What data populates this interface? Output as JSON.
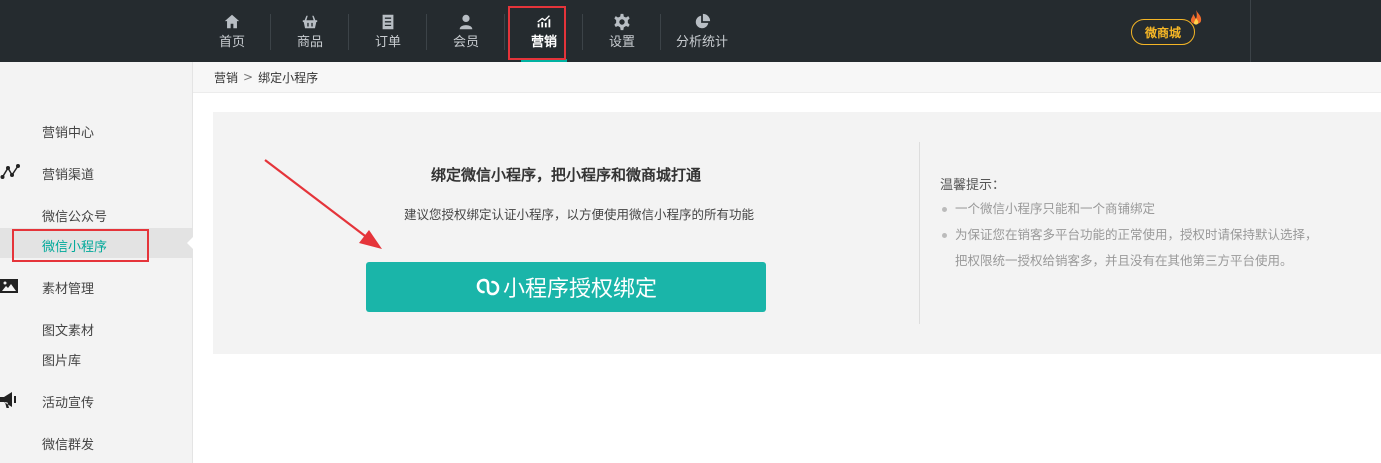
{
  "nav": {
    "items": [
      {
        "label": "首页",
        "icon": "home-icon"
      },
      {
        "label": "商品",
        "icon": "basket-icon"
      },
      {
        "label": "订单",
        "icon": "order-icon"
      },
      {
        "label": "会员",
        "icon": "user-icon"
      },
      {
        "label": "营销",
        "icon": "chart-up-icon",
        "active": true
      },
      {
        "label": "设置",
        "icon": "gear-icon"
      },
      {
        "label": "分析统计",
        "icon": "pie-icon"
      }
    ],
    "shop_badge": "微商城"
  },
  "breadcrumb": {
    "root": "营销",
    "separator": ">",
    "current": "绑定小程序"
  },
  "sidebar": {
    "items": [
      {
        "label": "营销中心"
      },
      {
        "label": "营销渠道",
        "icon": "channel-icon"
      },
      {
        "label": "微信公众号"
      },
      {
        "label": "微信小程序",
        "active": true
      },
      {
        "label": "素材管理",
        "icon": "image-icon"
      },
      {
        "label": "图文素材"
      },
      {
        "label": "图片库"
      },
      {
        "label": "活动宣传",
        "icon": "megaphone-icon"
      },
      {
        "label": "微信群发"
      }
    ]
  },
  "main": {
    "title": "绑定微信小程序，把小程序和微商城打通",
    "description": "建议您授权绑定认证小程序，以方便使用微信小程序的所有功能",
    "bind_button_label": "小程序授权绑定",
    "tips_title": "温馨提示：",
    "tips": [
      "一个微信小程序只能和一个商铺绑定",
      "为保证您在销客多平台功能的正常使用，授权时请保持默认选择，",
      "把权限统一授权给销客多，并且没有在其他第三方平台使用。"
    ]
  },
  "colors": {
    "topbar": "#252b2f",
    "accent": "#1ab5a9",
    "highlight": "#e5343a",
    "badge": "#f4b526"
  }
}
